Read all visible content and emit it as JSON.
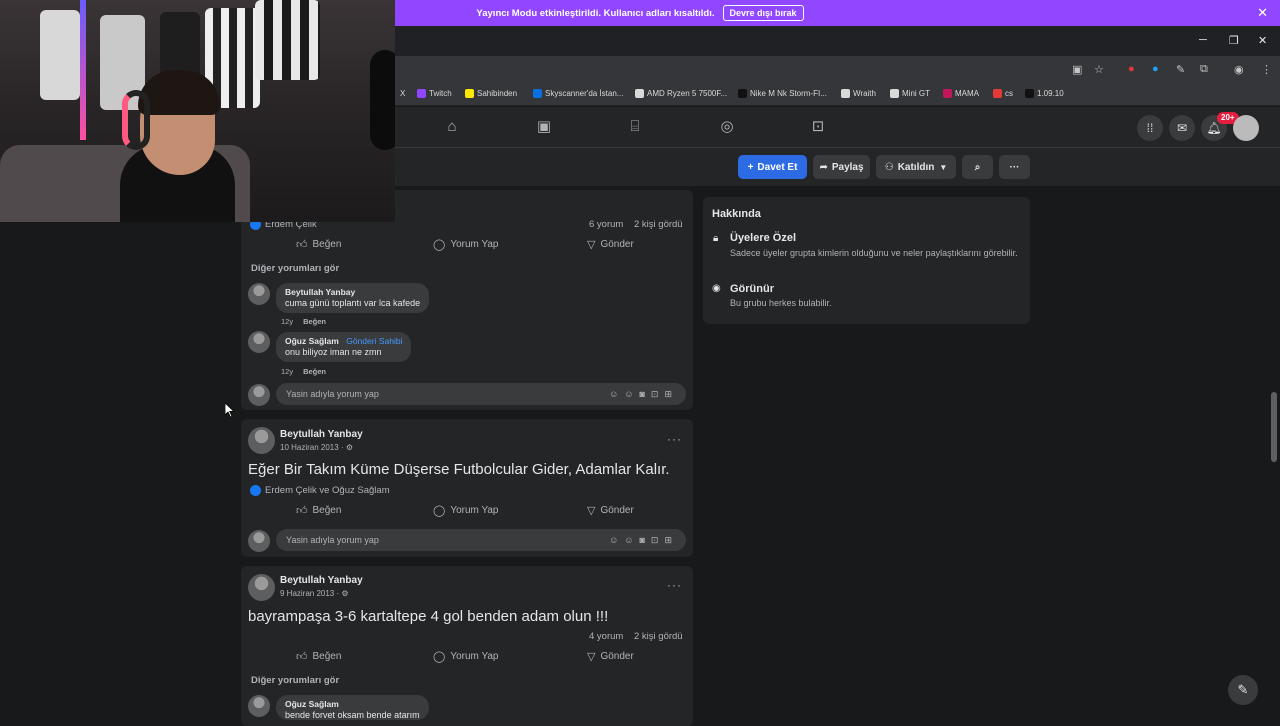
{
  "streamer_bar": {
    "message": "Yayıncı Modu etkinleştirildi. Kullanıcı adları kısaltıldı.",
    "disable_button": "Devre dışı bırak",
    "close_glyph": "✕"
  },
  "window_controls": {
    "minimize": "─",
    "restore": "❐",
    "close": "✕"
  },
  "bookmarks": [
    {
      "label": "X",
      "color": "#e8eaed"
    },
    {
      "label": "Twitch",
      "color": "#9147ff"
    },
    {
      "label": "Sahibinden",
      "color": "#ffe800"
    },
    {
      "label": "Skyscanner'da İstan...",
      "color": "#0770e3"
    },
    {
      "label": "AMD Ryzen 5 7500F...",
      "color": "#d9d9d9"
    },
    {
      "label": "Nike M Nk Storm-FI...",
      "color": "#111111"
    },
    {
      "label": "Wraith",
      "color": "#d9d9d9"
    },
    {
      "label": "Mini GT",
      "color": "#d9d9d9"
    },
    {
      "label": "MAMA",
      "color": "#c2185b"
    },
    {
      "label": "cs",
      "color": "#e53935"
    },
    {
      "label": "1.09.10",
      "color": "#111111"
    }
  ],
  "fb_nav": {
    "notification_count": "20+"
  },
  "group_actions": {
    "invite_label": "Davet Et",
    "share_label": "Paylaş",
    "joined_label": "Katıldın"
  },
  "post1": {
    "liked_by_partial": "Erdem Çelik",
    "comments_count": "6 yorum",
    "seen_count": "2 kişi gördü",
    "like_label": "Beğen",
    "comment_label": "Yorum Yap",
    "send_label": "Gönder",
    "more_comments": "Diğer yorumları gör",
    "comments": [
      {
        "name": "Beytullah Yanbay",
        "badge": "",
        "text": "cuma günü toplantı var lca kafede",
        "age": "12y",
        "like": "Beğen"
      },
      {
        "name": "Oğuz Sağlam",
        "badge": "Gönderi Sahibi",
        "text": "onu biliyoz iman ne zmn",
        "age": "12y",
        "like": "Beğen"
      }
    ],
    "comment_placeholder": "Yasin adıyla yorum yap"
  },
  "post2": {
    "author": "Beytullah Yanbay",
    "date": "10 Haziran 2013 · ⚙",
    "text": "Eğer Bir Takım Küme Düşerse Futbolcular Gider, Adamlar Kalır.",
    "liked_by": "Erdem Çelik ve Oğuz Sağlam",
    "like_label": "Beğen",
    "comment_label": "Yorum Yap",
    "send_label": "Gönder",
    "comment_placeholder": "Yasin adıyla yorum yap"
  },
  "post3": {
    "author": "Beytullah Yanbay",
    "date": "9 Haziran 2013 · ⚙",
    "text": "bayrampaşa 3-6 kartaltepe 4 gol benden adam olun !!!",
    "comments_count": "4 yorum",
    "seen_count": "2 kişi gördü",
    "like_label": "Beğen",
    "comment_label": "Yorum Yap",
    "send_label": "Gönder",
    "more_comments": "Diğer yorumları gör",
    "comment_name": "Oğuz Sağlam",
    "comment_text_partial": "bende forvet oksam bende atarım"
  },
  "about": {
    "title": "Hakkında",
    "private_title": "Üyelere Özel",
    "private_desc": "Sadece üyeler grupta kimlerin olduğunu ve neler paylaştıklarını görebilir.",
    "visible_title": "Görünür",
    "visible_desc": "Bu grubu herkes bulabilir."
  },
  "colors": {
    "streamer_purple": "#9147ff",
    "fb_blue": "#2d6be4",
    "card_bg": "#242526",
    "page_bg": "#18191a"
  }
}
